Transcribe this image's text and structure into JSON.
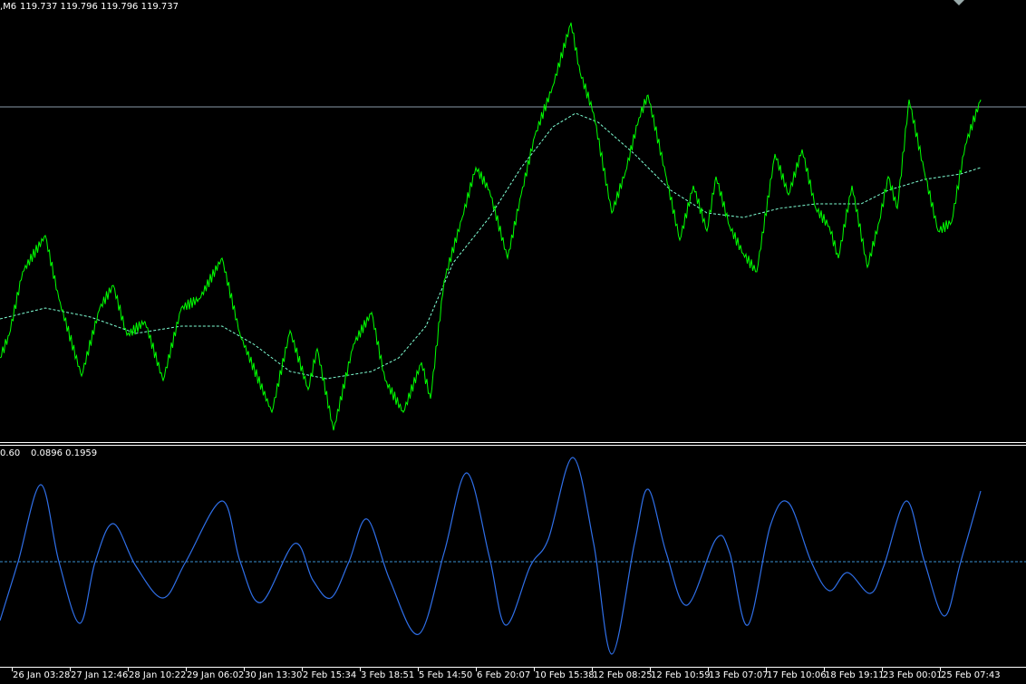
{
  "main_chart": {
    "header_symbol": ",M6",
    "header_ohlc": "119.737 119.796 119.796 119.737",
    "price_color": "#00ff00",
    "ma_color": "#7fffd4",
    "level_line_color": "#8a9aa8",
    "price_series": [
      [
        0,
        119.46
      ],
      [
        10,
        119.485
      ],
      [
        25,
        119.555
      ],
      [
        50,
        119.595
      ],
      [
        65,
        119.525
      ],
      [
        90,
        119.44
      ],
      [
        110,
        119.515
      ],
      [
        125,
        119.54
      ],
      [
        140,
        119.485
      ],
      [
        160,
        119.5
      ],
      [
        180,
        119.435
      ],
      [
        200,
        119.515
      ],
      [
        220,
        119.525
      ],
      [
        245,
        119.57
      ],
      [
        265,
        119.485
      ],
      [
        300,
        119.4
      ],
      [
        320,
        119.49
      ],
      [
        340,
        119.425
      ],
      [
        350,
        119.47
      ],
      [
        368,
        119.38
      ],
      [
        390,
        119.475
      ],
      [
        410,
        119.51
      ],
      [
        425,
        119.435
      ],
      [
        445,
        119.4
      ],
      [
        465,
        119.455
      ],
      [
        475,
        119.415
      ],
      [
        490,
        119.545
      ],
      [
        510,
        119.615
      ],
      [
        525,
        119.67
      ],
      [
        540,
        119.645
      ],
      [
        560,
        119.57
      ],
      [
        575,
        119.64
      ],
      [
        590,
        119.705
      ],
      [
        610,
        119.76
      ],
      [
        630,
        119.83
      ],
      [
        640,
        119.775
      ],
      [
        655,
        119.73
      ],
      [
        675,
        119.62
      ],
      [
        690,
        119.665
      ],
      [
        705,
        119.725
      ],
      [
        715,
        119.75
      ],
      [
        735,
        119.66
      ],
      [
        750,
        119.59
      ],
      [
        765,
        119.65
      ],
      [
        780,
        119.6
      ],
      [
        790,
        119.66
      ],
      [
        805,
        119.605
      ],
      [
        820,
        119.575
      ],
      [
        835,
        119.555
      ],
      [
        855,
        119.685
      ],
      [
        870,
        119.64
      ],
      [
        885,
        119.69
      ],
      [
        900,
        119.625
      ],
      [
        915,
        119.605
      ],
      [
        925,
        119.57
      ],
      [
        940,
        119.65
      ],
      [
        957,
        119.56
      ],
      [
        970,
        119.61
      ],
      [
        980,
        119.66
      ],
      [
        990,
        119.625
      ],
      [
        1003,
        119.745
      ],
      [
        1020,
        119.665
      ],
      [
        1035,
        119.6
      ],
      [
        1050,
        119.61
      ],
      [
        1065,
        119.695
      ],
      [
        1082,
        119.745
      ]
    ],
    "ma_series": [
      [
        0,
        119.503
      ],
      [
        50,
        119.515
      ],
      [
        100,
        119.505
      ],
      [
        150,
        119.487
      ],
      [
        200,
        119.495
      ],
      [
        245,
        119.495
      ],
      [
        280,
        119.475
      ],
      [
        320,
        119.445
      ],
      [
        360,
        119.437
      ],
      [
        410,
        119.445
      ],
      [
        440,
        119.46
      ],
      [
        470,
        119.495
      ],
      [
        500,
        119.565
      ],
      [
        540,
        119.615
      ],
      [
        575,
        119.67
      ],
      [
        610,
        119.715
      ],
      [
        635,
        119.73
      ],
      [
        660,
        119.72
      ],
      [
        700,
        119.685
      ],
      [
        740,
        119.645
      ],
      [
        780,
        119.62
      ],
      [
        820,
        119.615
      ],
      [
        860,
        119.625
      ],
      [
        900,
        119.63
      ],
      [
        950,
        119.63
      ],
      [
        980,
        119.645
      ],
      [
        1020,
        119.657
      ],
      [
        1060,
        119.663
      ],
      [
        1082,
        119.67
      ]
    ],
    "level_price": 119.737
  },
  "oscillator": {
    "header_left": "0.60",
    "header_values": "0.0896 0.1959",
    "line_color": "#2f6fe8",
    "zero_color": "#3a8fd0",
    "series": [
      [
        0,
        -0.65
      ],
      [
        20,
        0
      ],
      [
        45,
        0.85
      ],
      [
        65,
        0
      ],
      [
        88,
        -0.68
      ],
      [
        105,
        0
      ],
      [
        125,
        0.42
      ],
      [
        150,
        -0.05
      ],
      [
        180,
        -0.4
      ],
      [
        205,
        0
      ],
      [
        245,
        0.67
      ],
      [
        265,
        0
      ],
      [
        288,
        -0.45
      ],
      [
        325,
        0.2
      ],
      [
        345,
        -0.2
      ],
      [
        365,
        -0.4
      ],
      [
        385,
        0
      ],
      [
        405,
        0.47
      ],
      [
        430,
        -0.2
      ],
      [
        462,
        -0.8
      ],
      [
        490,
        0.1
      ],
      [
        515,
        0.98
      ],
      [
        540,
        0.05
      ],
      [
        558,
        -0.7
      ],
      [
        585,
        -0.05
      ],
      [
        605,
        0.25
      ],
      [
        632,
        1.15
      ],
      [
        655,
        0.2
      ],
      [
        675,
        -1.02
      ],
      [
        700,
        0.2
      ],
      [
        715,
        0.8
      ],
      [
        735,
        0.1
      ],
      [
        758,
        -0.48
      ],
      [
        790,
        0.25
      ],
      [
        805,
        0.1
      ],
      [
        825,
        -0.7
      ],
      [
        850,
        0.4
      ],
      [
        870,
        0.65
      ],
      [
        895,
        0
      ],
      [
        915,
        -0.32
      ],
      [
        935,
        -0.12
      ],
      [
        960,
        -0.35
      ],
      [
        975,
        -0.05
      ],
      [
        1000,
        0.67
      ],
      [
        1020,
        0
      ],
      [
        1042,
        -0.6
      ],
      [
        1060,
        0
      ],
      [
        1082,
        0.78
      ]
    ]
  },
  "time_axis": [
    "26 Jan 03:28",
    "27 Jan 12:46",
    "28 Jan 10:22",
    "29 Jan 06:02",
    "30 Jan 13:30",
    "2 Feb 15:34",
    "3 Feb 18:51",
    "5 Feb 14:50",
    "6 Feb 20:07",
    "10 Feb 15:38",
    "12 Feb 08:25",
    "12 Feb 10:59",
    "13 Feb 07:07",
    "17 Feb 10:06",
    "18 Feb 19:11",
    "23 Feb 00:01",
    "25 Feb 07:43"
  ]
}
